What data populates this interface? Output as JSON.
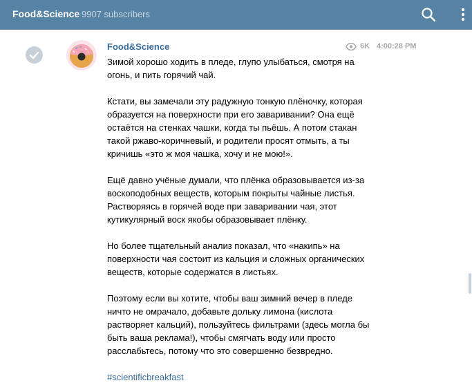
{
  "header": {
    "title": "Food&Science",
    "subscribers": "9907 subscribers",
    "search_icon": "search-icon",
    "more_icon": "more-vertical-icon"
  },
  "message": {
    "author": "Food&Science",
    "views": "6K",
    "time": "4:00:28 PM",
    "paragraphs": [
      "Зимой хорошо ходить в пледе, глупо улыбаться, смотря на\nогонь, и пить горячий чай.",
      "Кстати, вы замечали эту радужную тонкую плёночку, которая\nобразуется на поверхности при его заваривании? Она ещё\nостаётся на стенках чашки, когда ты пьёшь. А потом стакан\nтакой ржаво-коричневый, и родители просят отмыть, а ты\nкричишь «это ж моя чашка, хочу и не мою!».",
      "Ещё давно учёные думали, что плёнка образовывается из-за\nвоскоподобных веществ, которым покрыты чайные листья.\nРастворяясь в горячей воде при заваривании чая, этот\nкутикулярный воск якобы образовывает плёнку.",
      "Но более тщательный анализ показал, что «накипь» на\nповерхности чая состоит из кальция и сложных органических\nвеществ, которые содержатся в листьях.",
      "Поэтому если вы хотите, чтобы ваш зимний вечер в пледе\nничто не омрачало, добавьте дольку лимона (кислота\nрастворяет кальций), пользуйтесь фильтрами (здесь могла бы\nбыть ваша реклама!), чтобы смягчать воду или просто\nрасслабьтесь, потому что это совершенно безвредно."
    ],
    "hashtag": "#scientificbreakfast"
  },
  "colors": {
    "header_bg": "#5682a3",
    "link": "#3a6d99",
    "meta": "#a8a8a8"
  }
}
